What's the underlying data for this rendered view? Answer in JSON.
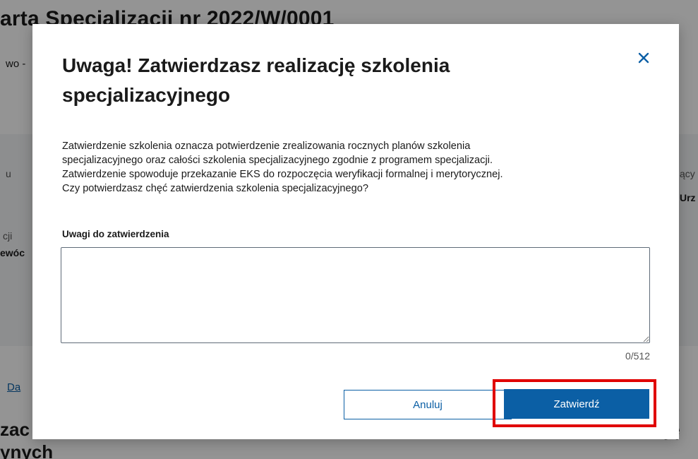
{
  "background": {
    "title": "arta Specjalizacji nr 2022/W/0001",
    "subtitle": "wo -",
    "fragments": {
      "label_left_1": "u",
      "label_left_2": "cji",
      "value_left_2": "ewóc",
      "label_right_1": "ący",
      "value_right_1": "Urz"
    },
    "link_text": "Da",
    "section_title_line1": "zac",
    "section_title_line2": "ynych",
    "section_title_right": "ję"
  },
  "modal": {
    "title": "Uwaga! Zatwierdzasz realizację szkolenia specjalizacyjnego",
    "description_lines": [
      "Zatwierdzenie szkolenia oznacza potwierdzenie zrealizowania rocznych planów szkolenia",
      "specjalizacyjnego oraz całości szkolenia specjalizacyjnego zgodnie z programem specjalizacji.",
      "Zatwierdzenie spowoduje przekazanie EKS do rozpoczęcia weryfikacji formalnej i merytorycznej.",
      "Czy potwierdzasz chęć zatwierdzenia szkolenia specjalizacyjnego?"
    ],
    "comment_field": {
      "label": "Uwagi do zatwierdzenia",
      "value": "",
      "counter": "0/512"
    },
    "buttons": {
      "cancel": "Anuluj",
      "confirm": "Zatwierdź"
    },
    "close_icon": "close-icon"
  },
  "colors": {
    "primary": "#0b5fa5",
    "highlight": "#e00000",
    "overlay": "rgba(0,0,0,0.42)"
  }
}
